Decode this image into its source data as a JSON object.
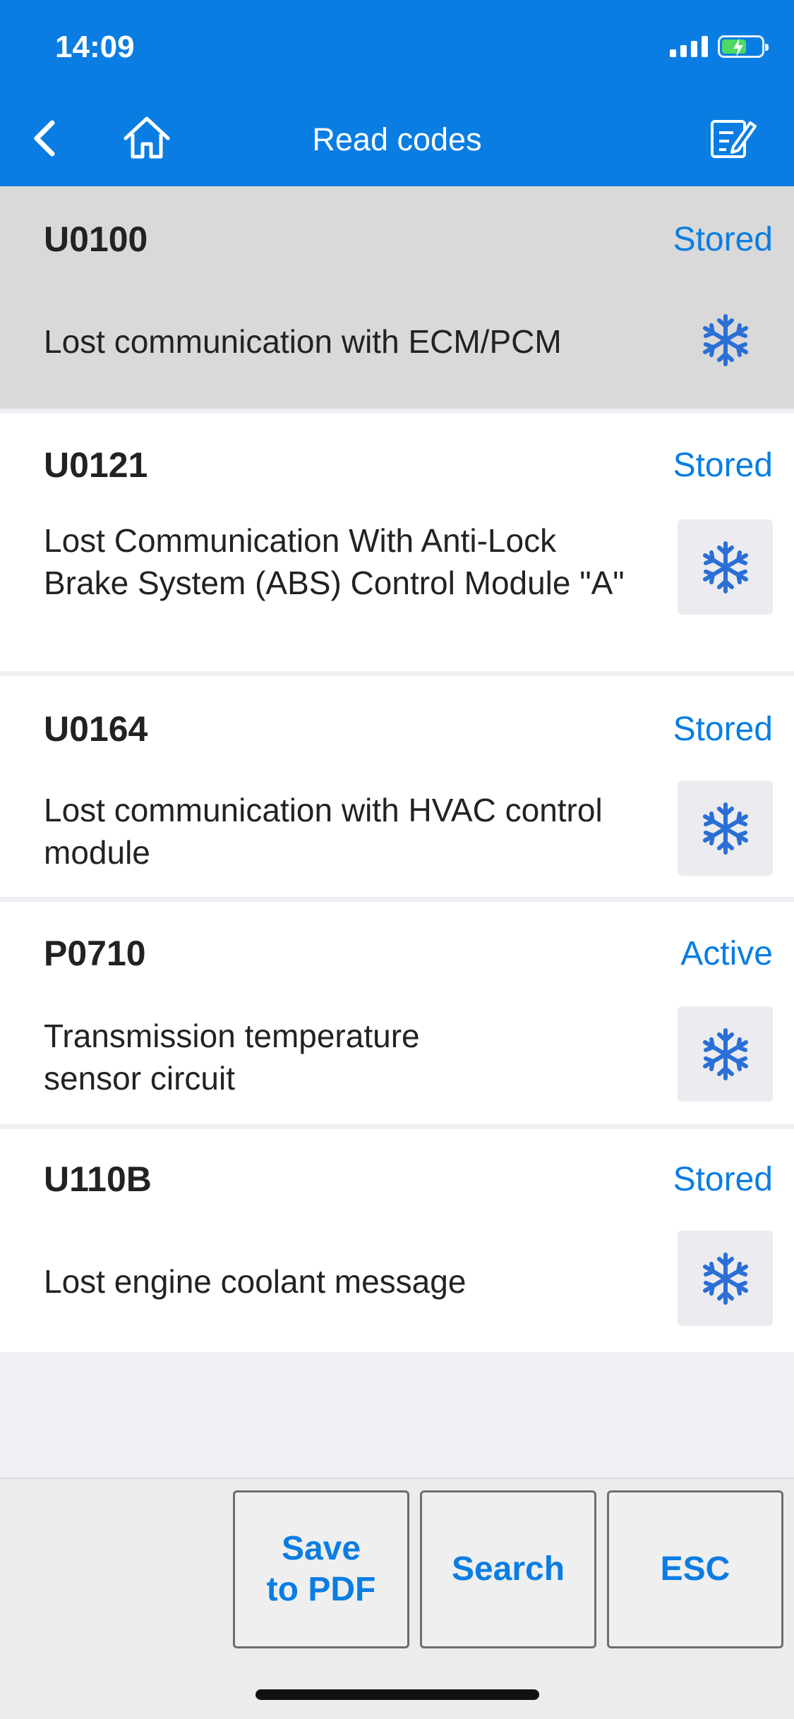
{
  "status_bar": {
    "time": "14:09"
  },
  "nav": {
    "title": "Read codes"
  },
  "codes": [
    {
      "code": "U0100",
      "status": "Stored",
      "description": "Lost communication with ECM/PCM"
    },
    {
      "code": "U0121",
      "status": "Stored",
      "description": "Lost Communication With Anti-Lock Brake System (ABS) Control Module \"A\""
    },
    {
      "code": "U0164",
      "status": "Stored",
      "description": "Lost communication with HVAC control module"
    },
    {
      "code": "P0710",
      "status": "Active",
      "description": "Transmission temperature sensor circuit"
    },
    {
      "code": "U110B",
      "status": "Stored",
      "description": "Lost engine coolant message"
    }
  ],
  "actions": {
    "save_pdf": "Save to PDF",
    "search": "Search",
    "esc": "ESC"
  },
  "colors": {
    "accent": "#0a7de3",
    "selected_row": "#d9d9d9",
    "battery": "#4cd964"
  },
  "icons": {
    "back": "chevron-left-icon",
    "home": "home-icon",
    "edit": "edit-icon",
    "freeze_frame": "snowflake-icon"
  }
}
